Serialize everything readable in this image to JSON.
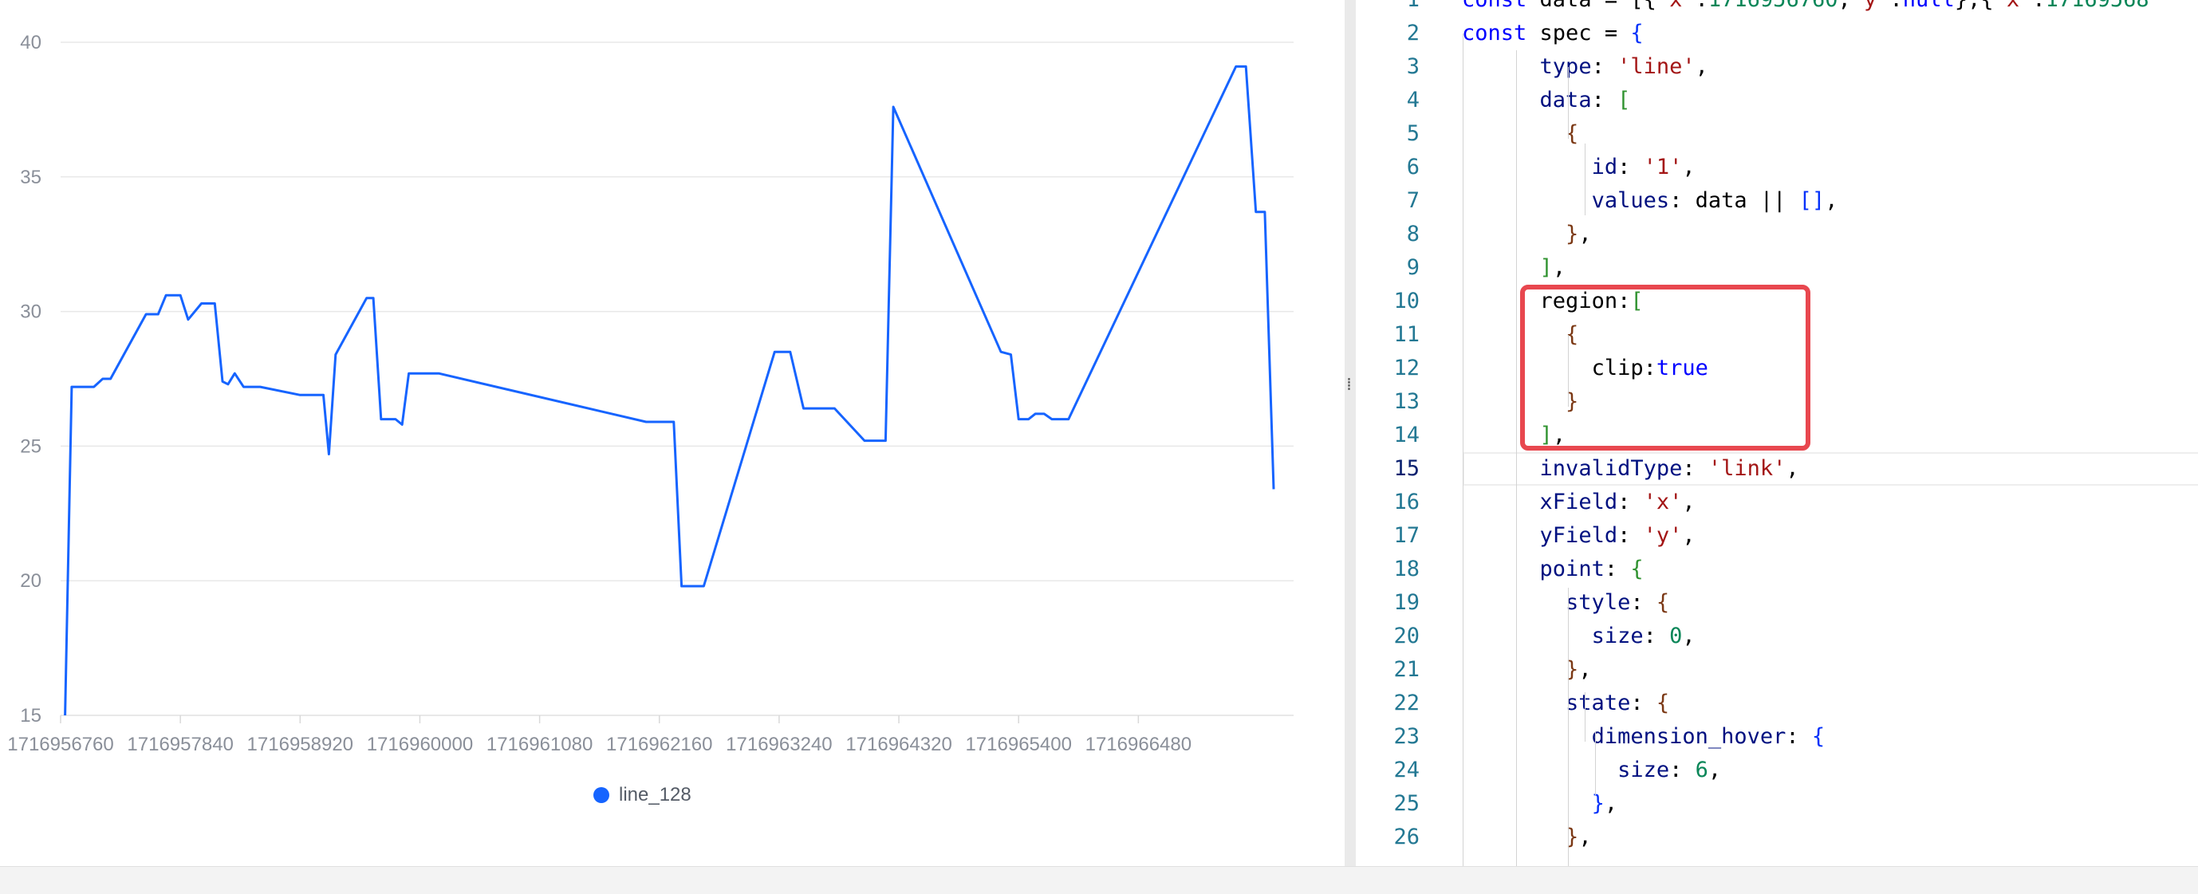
{
  "chart": {
    "legend": {
      "label": "line_128",
      "color": "#1664ff"
    },
    "line_color": "#1664ff",
    "grid_color": "#e8e8e8"
  },
  "chart_data": {
    "type": "line",
    "title": "",
    "xlabel": "",
    "ylabel": "",
    "ylim": [
      15,
      40
    ],
    "yticks": [
      "40",
      "35",
      "30",
      "25",
      "20",
      "15"
    ],
    "xticks": [
      "1716956760",
      "1716957840",
      "1716958920",
      "1716960000",
      "1716961080",
      "1716962160",
      "1716963240",
      "1716964320",
      "1716965400",
      "1716966480"
    ],
    "xlim": [
      1716956760,
      1716967880
    ],
    "grid": true,
    "legend_position": "bottom",
    "series": [
      {
        "name": "line_128",
        "color": "#1664ff",
        "points": [
          [
            1716956800,
            15.0
          ],
          [
            1716956860,
            27.2
          ],
          [
            1716957060,
            27.2
          ],
          [
            1716957140,
            27.5
          ],
          [
            1716957210,
            27.5
          ],
          [
            1716957530,
            29.9
          ],
          [
            1716957640,
            29.9
          ],
          [
            1716957710,
            30.6
          ],
          [
            1716957840,
            30.6
          ],
          [
            1716957910,
            29.7
          ],
          [
            1716958030,
            30.3
          ],
          [
            1716958150,
            30.3
          ],
          [
            1716958220,
            27.4
          ],
          [
            1716958270,
            27.3
          ],
          [
            1716958330,
            27.7
          ],
          [
            1716958410,
            27.2
          ],
          [
            1716958560,
            27.2
          ],
          [
            1716958920,
            26.9
          ],
          [
            1716959060,
            26.9
          ],
          [
            1716959130,
            26.9
          ],
          [
            1716959180,
            24.7
          ],
          [
            1716959240,
            28.4
          ],
          [
            1716959520,
            30.5
          ],
          [
            1716959580,
            30.5
          ],
          [
            1716959650,
            26.0
          ],
          [
            1716959780,
            26.0
          ],
          [
            1716959840,
            25.8
          ],
          [
            1716959900,
            27.7
          ],
          [
            1716959980,
            27.7
          ],
          [
            1716960170,
            27.7
          ],
          [
            1716962040,
            25.9
          ],
          [
            1716962290,
            25.9
          ],
          [
            1716962360,
            19.8
          ],
          [
            1716962560,
            19.8
          ],
          [
            1716963200,
            28.5
          ],
          [
            1716963340,
            28.5
          ],
          [
            1716963460,
            26.4
          ],
          [
            1716963740,
            26.4
          ],
          [
            1716964010,
            25.2
          ],
          [
            1716964200,
            25.2
          ],
          [
            1716964270,
            37.6
          ],
          [
            1716965240,
            28.5
          ],
          [
            1716965330,
            28.4
          ],
          [
            1716965400,
            26.0
          ],
          [
            1716965490,
            26.0
          ],
          [
            1716965550,
            26.2
          ],
          [
            1716965630,
            26.2
          ],
          [
            1716965700,
            26.0
          ],
          [
            1716965850,
            26.0
          ],
          [
            1716967360,
            39.1
          ],
          [
            1716967450,
            39.1
          ],
          [
            1716967540,
            33.7
          ],
          [
            1716967620,
            33.7
          ],
          [
            1716967700,
            23.4
          ]
        ]
      }
    ]
  },
  "editor": {
    "current_line": 15,
    "lines": [
      {
        "n": "1",
        "tokens": [
          [
            "t-kw",
            "const "
          ],
          [
            "t-def",
            "data = [{"
          ],
          [
            "t-str",
            "'x'"
          ],
          [
            "t-def",
            ":"
          ],
          [
            "t-num",
            "1716956760"
          ],
          [
            "t-def",
            ","
          ],
          [
            "t-str",
            "'y'"
          ],
          [
            "t-def",
            ":"
          ],
          [
            "t-kw",
            "null"
          ],
          [
            "t-def",
            "},{"
          ],
          [
            "t-str",
            "'x'"
          ],
          [
            "t-def",
            ":"
          ],
          [
            "t-num",
            "17169568"
          ]
        ]
      },
      {
        "n": "2",
        "tokens": [
          [
            "t-kw",
            "const "
          ],
          [
            "t-def",
            "spec = "
          ],
          [
            "t-b1",
            "{"
          ]
        ]
      },
      {
        "n": "3",
        "tokens": [
          [
            "t-def",
            "      "
          ],
          [
            "t-prop",
            "type"
          ],
          [
            "t-def",
            ": "
          ],
          [
            "t-str",
            "'line'"
          ],
          [
            "t-def",
            ","
          ]
        ]
      },
      {
        "n": "4",
        "tokens": [
          [
            "t-def",
            "      "
          ],
          [
            "t-prop",
            "data"
          ],
          [
            "t-def",
            ": "
          ],
          [
            "t-b2",
            "["
          ]
        ]
      },
      {
        "n": "5",
        "tokens": [
          [
            "t-def",
            "        "
          ],
          [
            "t-b3",
            "{"
          ]
        ]
      },
      {
        "n": "6",
        "tokens": [
          [
            "t-def",
            "          "
          ],
          [
            "t-prop",
            "id"
          ],
          [
            "t-def",
            ": "
          ],
          [
            "t-str",
            "'1'"
          ],
          [
            "t-def",
            ","
          ]
        ]
      },
      {
        "n": "7",
        "tokens": [
          [
            "t-def",
            "          "
          ],
          [
            "t-prop",
            "values"
          ],
          [
            "t-def",
            ": data || "
          ],
          [
            "t-b1",
            "[]"
          ],
          [
            "t-def",
            ","
          ]
        ]
      },
      {
        "n": "8",
        "tokens": [
          [
            "t-def",
            "        "
          ],
          [
            "t-b3",
            "}"
          ],
          [
            "t-def",
            ","
          ]
        ]
      },
      {
        "n": "9",
        "tokens": [
          [
            "t-def",
            "      "
          ],
          [
            "t-b2",
            "]"
          ],
          [
            "t-def",
            ","
          ]
        ]
      },
      {
        "n": "10",
        "tokens": [
          [
            "t-def",
            "      "
          ],
          [
            "t-def",
            "region:"
          ],
          [
            "t-b2",
            "["
          ]
        ]
      },
      {
        "n": "11",
        "tokens": [
          [
            "t-def",
            "        "
          ],
          [
            "t-b3",
            "{"
          ]
        ]
      },
      {
        "n": "12",
        "tokens": [
          [
            "t-def",
            "          "
          ],
          [
            "t-def",
            "clip:"
          ],
          [
            "t-lit",
            "true"
          ]
        ]
      },
      {
        "n": "13",
        "tokens": [
          [
            "t-def",
            "        "
          ],
          [
            "t-b3",
            "}"
          ]
        ]
      },
      {
        "n": "14",
        "tokens": [
          [
            "t-def",
            "      "
          ],
          [
            "t-b2",
            "]"
          ],
          [
            "t-def",
            ","
          ]
        ]
      },
      {
        "n": "15",
        "tokens": [
          [
            "t-def",
            "      "
          ],
          [
            "t-prop",
            "invalidType"
          ],
          [
            "t-def",
            ": "
          ],
          [
            "t-str",
            "'link'"
          ],
          [
            "t-def",
            ","
          ]
        ]
      },
      {
        "n": "16",
        "tokens": [
          [
            "t-def",
            "      "
          ],
          [
            "t-prop",
            "xField"
          ],
          [
            "t-def",
            ": "
          ],
          [
            "t-str",
            "'x'"
          ],
          [
            "t-def",
            ","
          ]
        ]
      },
      {
        "n": "17",
        "tokens": [
          [
            "t-def",
            "      "
          ],
          [
            "t-prop",
            "yField"
          ],
          [
            "t-def",
            ": "
          ],
          [
            "t-str",
            "'y'"
          ],
          [
            "t-def",
            ","
          ]
        ]
      },
      {
        "n": "18",
        "tokens": [
          [
            "t-def",
            "      "
          ],
          [
            "t-prop",
            "point"
          ],
          [
            "t-def",
            ": "
          ],
          [
            "t-b2",
            "{"
          ]
        ]
      },
      {
        "n": "19",
        "tokens": [
          [
            "t-def",
            "        "
          ],
          [
            "t-prop",
            "style"
          ],
          [
            "t-def",
            ": "
          ],
          [
            "t-b3",
            "{"
          ]
        ]
      },
      {
        "n": "20",
        "tokens": [
          [
            "t-def",
            "          "
          ],
          [
            "t-prop",
            "size"
          ],
          [
            "t-def",
            ": "
          ],
          [
            "t-num",
            "0"
          ],
          [
            "t-def",
            ","
          ]
        ]
      },
      {
        "n": "21",
        "tokens": [
          [
            "t-def",
            "        "
          ],
          [
            "t-b3",
            "}"
          ],
          [
            "t-def",
            ","
          ]
        ]
      },
      {
        "n": "22",
        "tokens": [
          [
            "t-def",
            "        "
          ],
          [
            "t-prop",
            "state"
          ],
          [
            "t-def",
            ": "
          ],
          [
            "t-b3",
            "{"
          ]
        ]
      },
      {
        "n": "23",
        "tokens": [
          [
            "t-def",
            "          "
          ],
          [
            "t-prop",
            "dimension_hover"
          ],
          [
            "t-def",
            ": "
          ],
          [
            "t-b1",
            "{"
          ]
        ]
      },
      {
        "n": "24",
        "tokens": [
          [
            "t-def",
            "            "
          ],
          [
            "t-prop",
            "size"
          ],
          [
            "t-def",
            ": "
          ],
          [
            "t-num",
            "6"
          ],
          [
            "t-def",
            ","
          ]
        ]
      },
      {
        "n": "25",
        "tokens": [
          [
            "t-def",
            "          "
          ],
          [
            "t-b1",
            "}"
          ],
          [
            "t-def",
            ","
          ]
        ]
      },
      {
        "n": "26",
        "tokens": [
          [
            "t-def",
            "        "
          ],
          [
            "t-b3",
            "}"
          ],
          [
            "t-def",
            ","
          ]
        ]
      }
    ]
  }
}
